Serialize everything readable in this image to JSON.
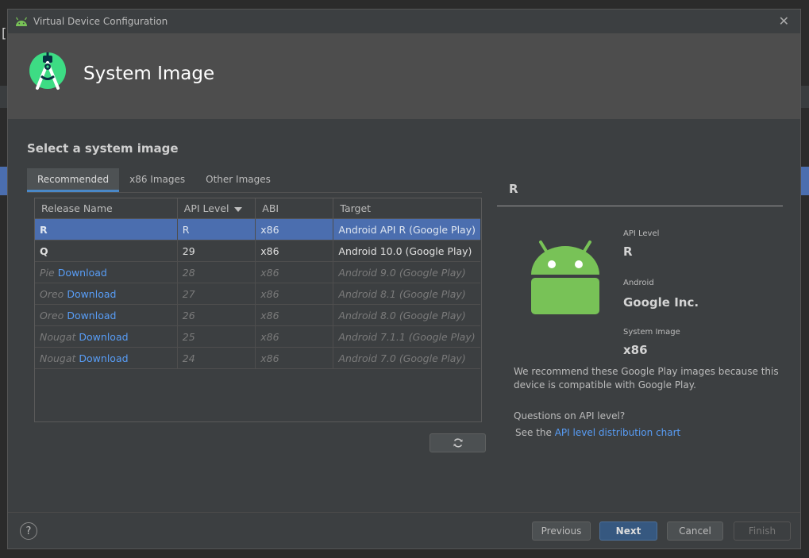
{
  "window": {
    "title": "Virtual Device Configuration",
    "close_glyph": "✕",
    "header_title": "System Image"
  },
  "section": {
    "title": "Select a system image"
  },
  "tabs": [
    {
      "label": "Recommended",
      "active": true
    },
    {
      "label": "x86 Images",
      "active": false
    },
    {
      "label": "Other Images",
      "active": false
    }
  ],
  "table": {
    "columns": [
      "Release Name",
      "API Level",
      "ABI",
      "Target"
    ],
    "rows": [
      {
        "release": "R",
        "download": "",
        "api": "R",
        "abi": "x86",
        "target": "Android API R (Google Play)",
        "state": "selected"
      },
      {
        "release": "Q",
        "download": "",
        "api": "29",
        "abi": "x86",
        "target": "Android 10.0 (Google Play)",
        "state": "enabled"
      },
      {
        "release": "Pie",
        "download": "Download",
        "api": "28",
        "abi": "x86",
        "target": "Android 9.0 (Google Play)",
        "state": "disabled"
      },
      {
        "release": "Oreo",
        "download": "Download",
        "api": "27",
        "abi": "x86",
        "target": "Android 8.1 (Google Play)",
        "state": "disabled"
      },
      {
        "release": "Oreo",
        "download": "Download",
        "api": "26",
        "abi": "x86",
        "target": "Android 8.0 (Google Play)",
        "state": "disabled"
      },
      {
        "release": "Nougat",
        "download": "Download",
        "api": "25",
        "abi": "x86",
        "target": "Android 7.1.1 (Google Play)",
        "state": "disabled"
      },
      {
        "release": "Nougat",
        "download": "Download",
        "api": "24",
        "abi": "x86",
        "target": "Android 7.0 (Google Play)",
        "state": "disabled"
      }
    ]
  },
  "detail": {
    "heading": "R",
    "api_level_label": "API Level",
    "api_level_value": "R",
    "vendor_label": "Android",
    "vendor_value": "Google Inc.",
    "system_image_label": "System Image",
    "system_image_value": "x86",
    "description": "We recommend these Google Play images because this device is compatible with Google Play.",
    "question": "Questions on API level?",
    "see_the": "See the ",
    "link_text": "API level distribution chart"
  },
  "footer": {
    "help_glyph": "?",
    "previous": "Previous",
    "next": "Next",
    "cancel": "Cancel",
    "finish": "Finish"
  },
  "colors": {
    "accent": "#4b6eaf",
    "link": "#589df6",
    "android_green": "#78c257"
  }
}
